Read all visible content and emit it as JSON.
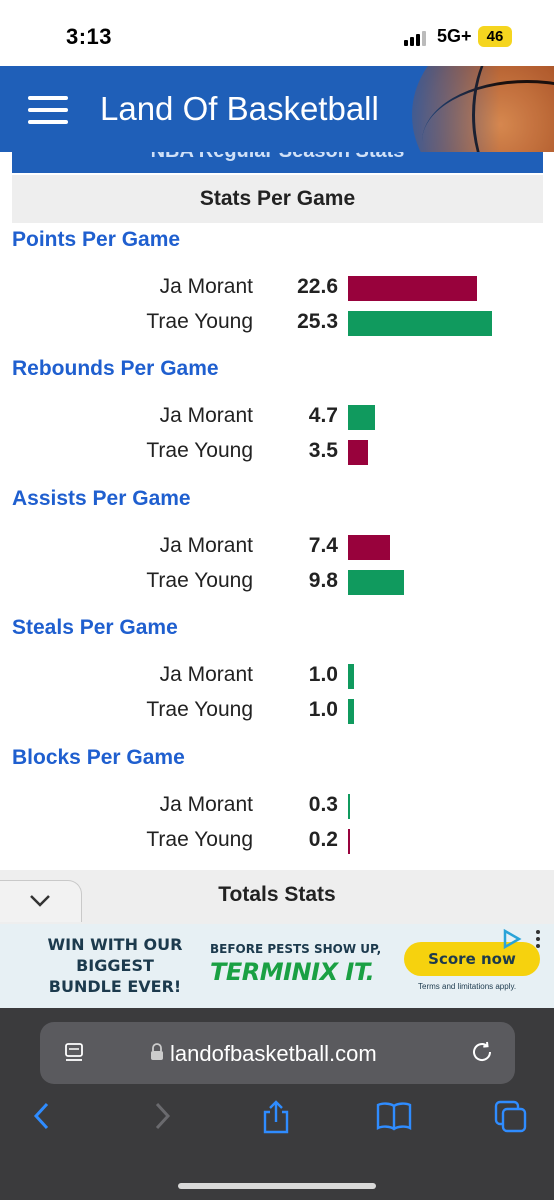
{
  "status": {
    "time": "3:13",
    "network": "5G+",
    "battery": "46"
  },
  "site": {
    "title": "Land Of Basketball",
    "section_peek": "NBA Regular Season Stats"
  },
  "stats_header": "Stats Per Game",
  "colors": {
    "ja": "#98023c",
    "trae": "#109a5e",
    "title_blue": "#1f5fcf",
    "header_blue": "#1f5fb8"
  },
  "sections": [
    {
      "title": "Points Per Game",
      "rows": [
        {
          "player": "Ja Morant",
          "value": "22.6",
          "num": 22.6,
          "color": "#98023c"
        },
        {
          "player": "Trae Young",
          "value": "25.3",
          "num": 25.3,
          "color": "#109a5e"
        }
      ]
    },
    {
      "title": "Rebounds Per Game",
      "rows": [
        {
          "player": "Ja Morant",
          "value": "4.7",
          "num": 4.7,
          "color": "#109a5e"
        },
        {
          "player": "Trae Young",
          "value": "3.5",
          "num": 3.5,
          "color": "#98023c"
        }
      ]
    },
    {
      "title": "Assists Per Game",
      "rows": [
        {
          "player": "Ja Morant",
          "value": "7.4",
          "num": 7.4,
          "color": "#98023c"
        },
        {
          "player": "Trae Young",
          "value": "9.8",
          "num": 9.8,
          "color": "#109a5e"
        }
      ]
    },
    {
      "title": "Steals Per Game",
      "rows": [
        {
          "player": "Ja Morant",
          "value": "1.0",
          "num": 1.0,
          "color": "#109a5e"
        },
        {
          "player": "Trae Young",
          "value": "1.0",
          "num": 1.0,
          "color": "#109a5e"
        }
      ]
    },
    {
      "title": "Blocks Per Game",
      "rows": [
        {
          "player": "Ja Morant",
          "value": "0.3",
          "num": 0.3,
          "color": "#109a5e"
        },
        {
          "player": "Trae Young",
          "value": "0.2",
          "num": 0.2,
          "color": "#98023c"
        }
      ]
    }
  ],
  "totals_header": "Totals Stats",
  "ad": {
    "headline": "WIN WITH OUR BIGGEST BUNDLE EVER!",
    "tagline": "BEFORE PESTS SHOW UP,",
    "brand": "TERMINIX IT.",
    "cta": "Score now",
    "terms": "Terms and limitations apply."
  },
  "browser": {
    "url": "landofbasketball.com"
  },
  "icons": [
    "hamburger-icon",
    "chevron-down-icon",
    "ad-choices-icon",
    "more-vert-icon",
    "reader-icon",
    "lock-icon",
    "reload-icon",
    "back-icon",
    "forward-icon",
    "share-icon",
    "bookmarks-icon",
    "tabs-icon"
  ]
}
